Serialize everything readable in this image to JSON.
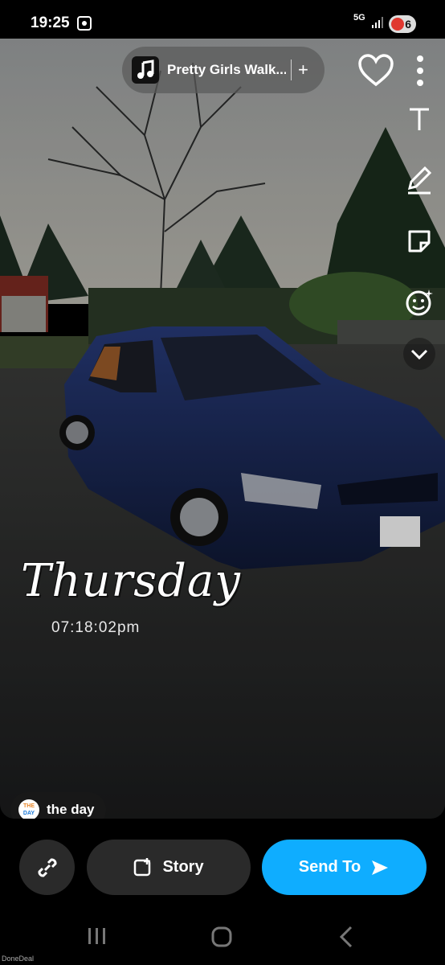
{
  "status_bar": {
    "time": "19:25",
    "network": "5G",
    "battery": "6"
  },
  "music": {
    "title": "Pretty Girls Walk...",
    "add_symbol": "+"
  },
  "side_tools": [
    "text-icon",
    "pencil-icon",
    "sticker-icon",
    "lens-icon",
    "chevron-down-icon"
  ],
  "sticker": {
    "day": "Thursday",
    "time": "07:18:02pm"
  },
  "day_chip": {
    "logo_top": "THE",
    "logo_bottom": "DAY",
    "label": "the day"
  },
  "actions": {
    "story_label": "Story",
    "send_label": "Send To"
  },
  "colors": {
    "send_button": "#0fadff",
    "dark_button": "#2a2a2a"
  },
  "watermark": "DoneDeal"
}
